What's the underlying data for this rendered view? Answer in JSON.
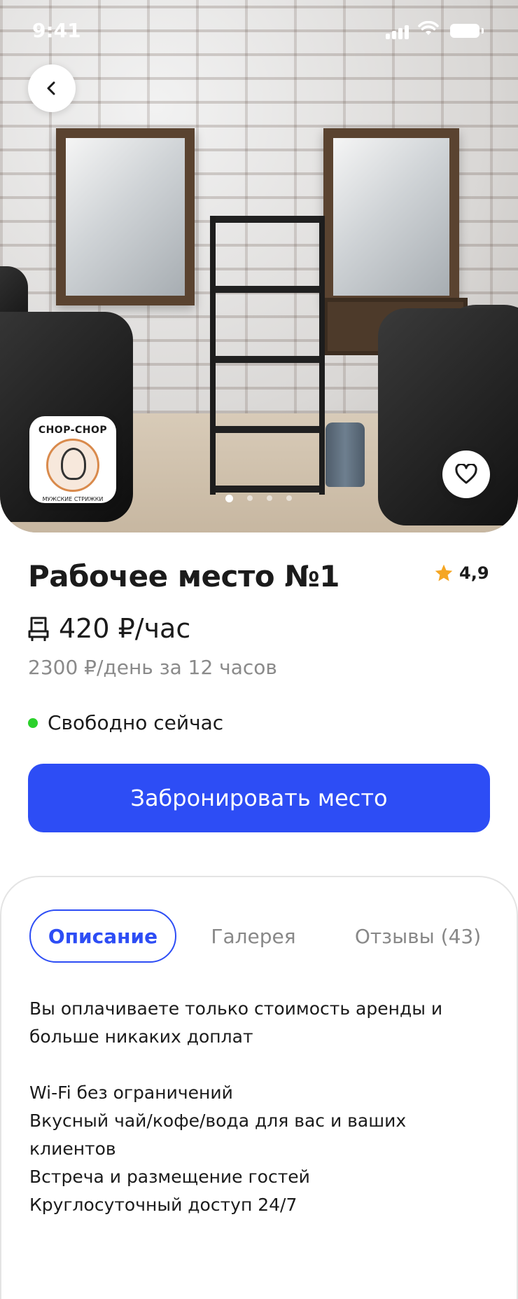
{
  "status_bar": {
    "time": "9:41"
  },
  "hero": {
    "logo": {
      "brand": "CHOP-CHOP",
      "subtitle": "МУЖСКИЕ СТРИЖКИ"
    },
    "carousel": {
      "count": 4,
      "active_index": 0
    }
  },
  "listing": {
    "title": "Рабочее место №1",
    "rating": "4,9",
    "price_per_hour": "420 ₽/час",
    "price_per_day": "2300 ₽/день за 12 часов",
    "availability": "Свободно сейчас"
  },
  "cta": {
    "label": "Забронировать место"
  },
  "tabs": [
    {
      "label": "Описание",
      "active": true
    },
    {
      "label": "Галерея",
      "active": false
    },
    {
      "label": "Отзывы (43)",
      "active": false
    }
  ],
  "description": {
    "intro_line1": "Вы оплачиваете только стоимость аренды и",
    "intro_line2": "больше никаких доплат",
    "features": [
      "Wi-Fi без ограничений",
      "Вкусный чай/кофе/вода для вас и ваших клиентов",
      "Встреча и размещение гостей",
      "Круглосуточный доступ 24/7"
    ]
  },
  "colors": {
    "accent": "#2d4df5",
    "available": "#2bd12b",
    "star": "#f5a623",
    "muted_text": "#8a8a8a"
  },
  "icons": [
    "back-arrow-icon",
    "heart-icon",
    "star-icon",
    "chair-icon",
    "signal-icon",
    "wifi-icon",
    "battery-icon"
  ]
}
